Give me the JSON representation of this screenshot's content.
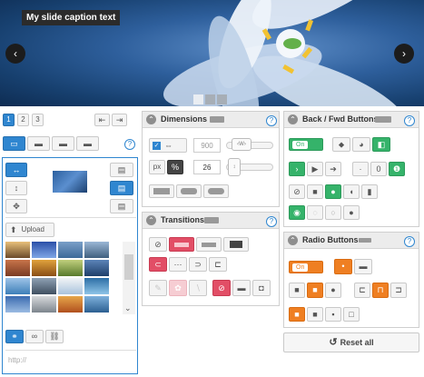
{
  "slider": {
    "caption": "My slide caption text",
    "prev_glyph": "‹",
    "next_glyph": "›",
    "dots": [
      {
        "active": true
      },
      {
        "active": false
      },
      {
        "active": false
      }
    ]
  },
  "pager": {
    "pages": [
      "1",
      "2",
      "3"
    ],
    "active": "1"
  },
  "help_glyph": "?",
  "media": {
    "upload_label": "Upload",
    "url_placeholder": "http://",
    "scroll_up": "⌃",
    "scroll_down": "⌄"
  },
  "dimensions": {
    "title": "Dimensions",
    "width_value": "900",
    "size_value": "26",
    "unit_label": "px",
    "checked": true
  },
  "transitions": {
    "title": "Transitions"
  },
  "back_fwd": {
    "title": "Back / Fwd Buttons",
    "toggle_label": "On"
  },
  "radio": {
    "title": "Radio Buttons",
    "toggle_label": "On"
  },
  "reset": {
    "label": "Reset all",
    "icon": "reset-icon"
  },
  "colors": {
    "accent_blue": "#2f86d0",
    "accent_green": "#35b36a",
    "accent_orange": "#ef7f22",
    "accent_red": "#e24e66"
  }
}
